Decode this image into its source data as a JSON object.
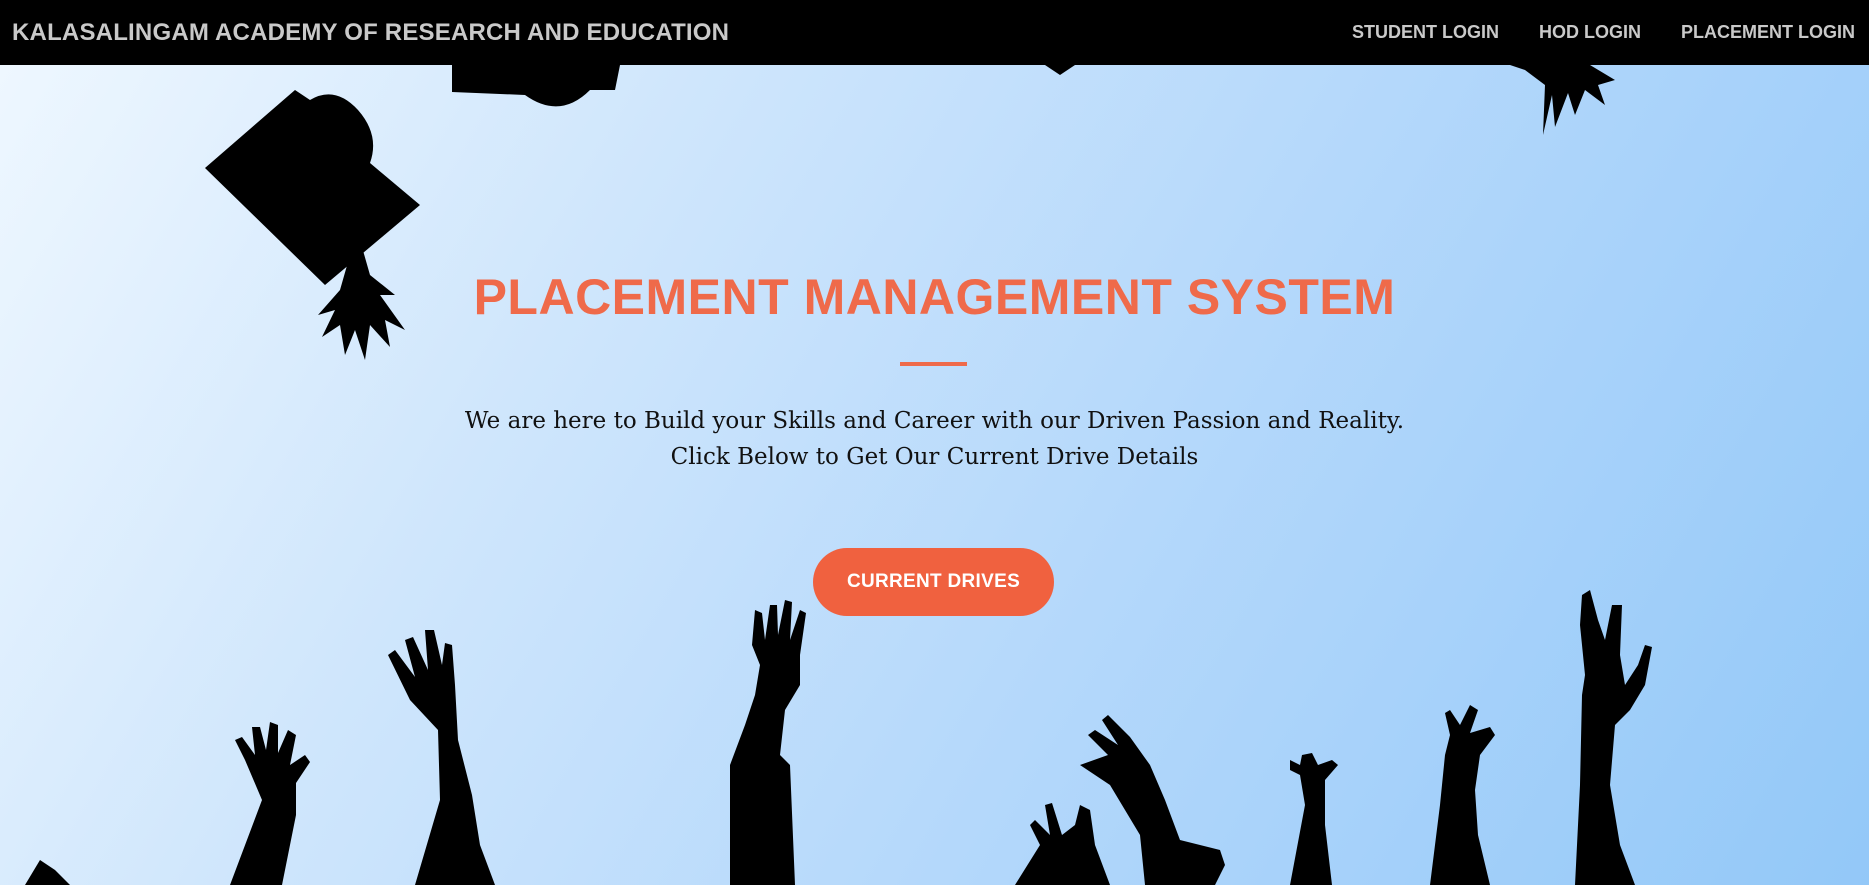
{
  "navbar": {
    "brand": "KALASALINGAM ACADEMY OF RESEARCH AND EDUCATION",
    "links": [
      "STUDENT LOGIN",
      "HOD LOGIN",
      "PLACEMENT LOGIN"
    ]
  },
  "hero": {
    "title": "PLACEMENT MANAGEMENT SYSTEM",
    "line1": "We are here to Build your Skills and Career with our Driven Passion and Reality.",
    "line2": "Click Below to Get Our Current Drive Details",
    "button_label": "CURRENT DRIVES"
  },
  "colors": {
    "accent": "#ef6a4a",
    "button": "#f0613f",
    "navbar_bg": "#000000",
    "nav_text": "#c9c9c9"
  }
}
